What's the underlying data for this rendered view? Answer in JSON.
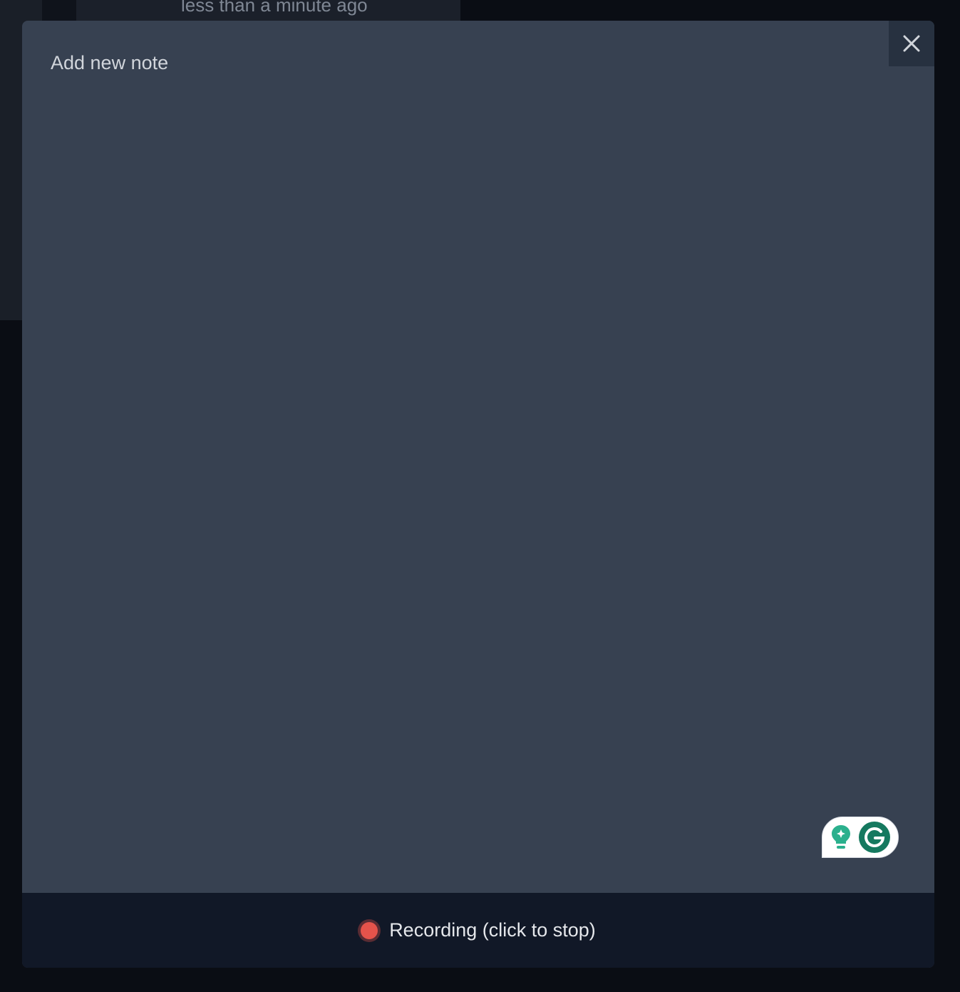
{
  "background": {
    "timestamp": "less than a minute ago"
  },
  "modal": {
    "note_placeholder": "Add new note",
    "note_value": "",
    "close_icon": "close-icon"
  },
  "grammarly": {
    "icons": [
      "lightbulb-sparkle-icon",
      "grammarly-g-icon"
    ]
  },
  "footer": {
    "record_label": "Recording (click to stop)",
    "record_icon": "recording-dot-icon"
  },
  "colors": {
    "modal_bg": "#374151",
    "footer_bg": "#111827",
    "recording_red": "#e5534b",
    "grammarly_green": "#15795f"
  }
}
